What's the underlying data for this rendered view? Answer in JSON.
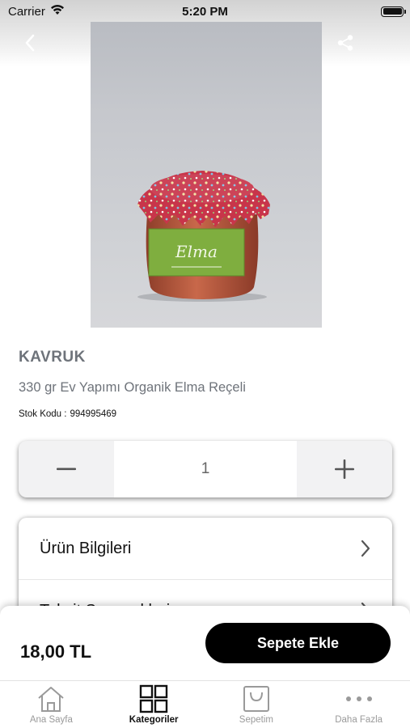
{
  "status_bar": {
    "carrier": "Carrier",
    "time": "5:20 PM"
  },
  "header": {
    "back_icon": "chevron-left-icon",
    "share_icon": "share-icon"
  },
  "product_image": {
    "label_text": "Elma"
  },
  "product": {
    "brand": "KAVRUK",
    "name": "330 gr Ev Yapımı Organik Elma Reçeli",
    "stock_label": "Stok Kodu :",
    "stock_code": "994995469"
  },
  "quantity": {
    "value": "1",
    "decrement_icon": "minus-icon",
    "increment_icon": "plus-icon"
  },
  "info_card": {
    "items": [
      {
        "label": "Ürün Bilgileri"
      },
      {
        "label": "Taksit Seçenekleri"
      }
    ]
  },
  "cart": {
    "price": "18,00 TL",
    "add_to_cart_label": "Sepete Ekle"
  },
  "tab_bar": {
    "tabs": [
      {
        "label": "Ana Sayfa",
        "icon": "home-icon",
        "active": false
      },
      {
        "label": "Kategoriler",
        "icon": "grid-icon",
        "active": true
      },
      {
        "label": "Sepetim",
        "icon": "shopping-bag-icon",
        "active": false
      },
      {
        "label": "Daha Fazla",
        "icon": "more-icon",
        "active": false
      }
    ]
  },
  "colors": {
    "primary": "#000000",
    "muted_text": "#6e737a",
    "inactive_tab": "#9a9a9a",
    "jar_lid": "#c8354a",
    "jar_label": "#7fae3f",
    "jam": "#b85a3c"
  }
}
